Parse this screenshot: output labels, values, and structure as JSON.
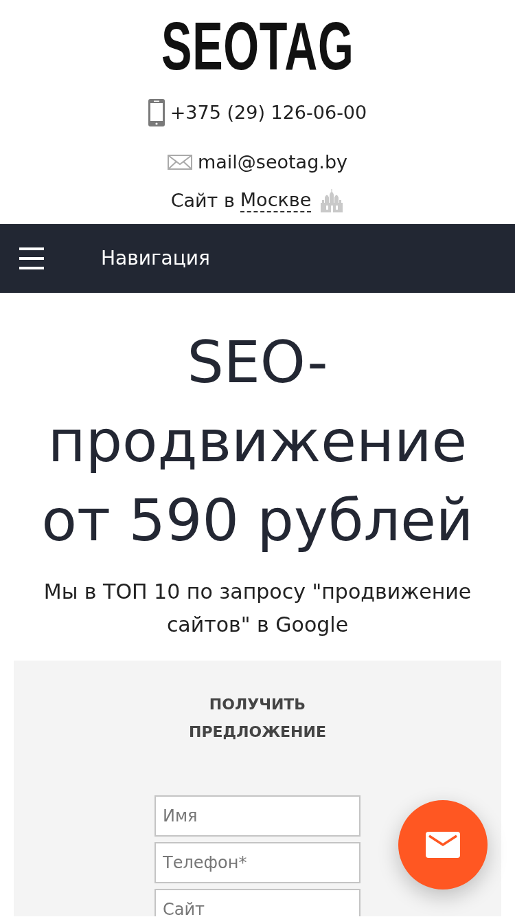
{
  "logo": {
    "text": "SEOTAG"
  },
  "contacts": {
    "phone": "+375 (29) 126-06-00",
    "email": "mail@seotag.by",
    "city_prefix": "Сайт в",
    "city_link": "Москве"
  },
  "navbar": {
    "label": "Навигация"
  },
  "hero": {
    "title": "SEO-продвижение от 590 рублей",
    "subtitle": "Мы в ТОП 10 по запросу \"продвижение сайтов\" в Google"
  },
  "form": {
    "title": "ПОЛУЧИТЬ ПРЕДЛОЖЕНИЕ",
    "fields": [
      {
        "placeholder": "Имя"
      },
      {
        "placeholder": "Телефон*"
      },
      {
        "placeholder": "Сайт"
      }
    ]
  }
}
